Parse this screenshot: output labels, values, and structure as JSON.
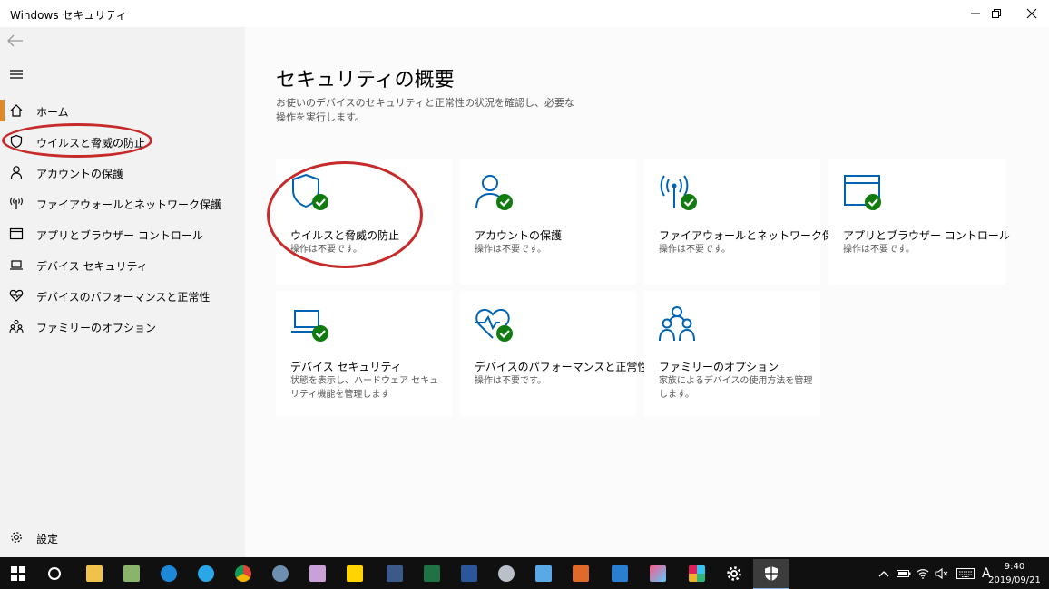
{
  "window": {
    "title": "Windows セキュリティ"
  },
  "sidebar": {
    "items": [
      {
        "label": "ホーム",
        "icon": "home-icon"
      },
      {
        "label": "ウイルスと脅威の防止",
        "icon": "shield-icon"
      },
      {
        "label": "アカウントの保護",
        "icon": "person-icon"
      },
      {
        "label": "ファイアウォールとネットワーク保護",
        "icon": "wifi-icon"
      },
      {
        "label": "アプリとブラウザー コントロール",
        "icon": "browser-icon"
      },
      {
        "label": "デバイス セキュリティ",
        "icon": "laptop-icon"
      },
      {
        "label": "デバイスのパフォーマンスと正常性",
        "icon": "heart-icon"
      },
      {
        "label": "ファミリーのオプション",
        "icon": "family-icon"
      }
    ],
    "settings_label": "設定"
  },
  "main": {
    "title": "セキュリティの概要",
    "description": "お使いのデバイスのセキュリティと正常性の状況を確認し、必要な操作を実行します。",
    "cards": [
      {
        "title": "ウイルスと脅威の防止",
        "desc": "操作は不要です。",
        "icon": "shield-check-icon"
      },
      {
        "title": "アカウントの保護",
        "desc": "操作は不要です。",
        "icon": "person-check-icon"
      },
      {
        "title": "ファイアウォールとネットワーク保護",
        "desc": "操作は不要です。",
        "icon": "antenna-check-icon"
      },
      {
        "title": "アプリとブラウザー コントロール",
        "desc": "操作は不要です。",
        "icon": "browser-check-icon"
      },
      {
        "title": "デバイス セキュリティ",
        "desc": "状態を表示し、ハードウェア セキュリティ機能を管理します",
        "icon": "laptop-check-icon"
      },
      {
        "title": "デバイスのパフォーマンスと正常性",
        "desc": "操作は不要です。",
        "icon": "heart-check-icon"
      },
      {
        "title": "ファミリーのオプション",
        "desc": "家族によるデバイスの使用方法を管理します。",
        "icon": "family-icon"
      }
    ]
  },
  "taskbar": {
    "ime_label": "A",
    "time": "9:40",
    "date": "2019/09/21"
  },
  "colors": {
    "accent": "#0063b1",
    "check": "#107c10",
    "active_marker": "#e08a2a",
    "annotation": "#c62a2a"
  }
}
